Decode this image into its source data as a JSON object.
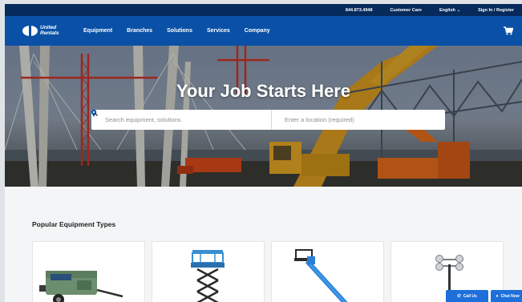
{
  "utility_bar": {
    "phone": "844.873.4948",
    "customer_care": "Customer Care",
    "language": "English",
    "sign_in": "Sign In / Register"
  },
  "brand": {
    "line1": "United",
    "line2": "Rentals"
  },
  "nav": {
    "items": [
      "Equipment",
      "Branches",
      "Solutions",
      "Services",
      "Company"
    ]
  },
  "hero": {
    "title": "Your Job Starts Here",
    "search_placeholder": "Search equipment, solutions",
    "location_placeholder": "Enter a location (required)"
  },
  "popular": {
    "title": "Popular Equipment Types",
    "cards": [
      "air-compressor",
      "scissor-lift",
      "boom-lift",
      "light-tower"
    ]
  },
  "floating": {
    "call_label": "Call Us",
    "chat_label": "Chat Now"
  },
  "colors": {
    "util_bar": "#062a5b",
    "nav_bar": "#0a50a6",
    "accent": "#1e6fd9"
  }
}
